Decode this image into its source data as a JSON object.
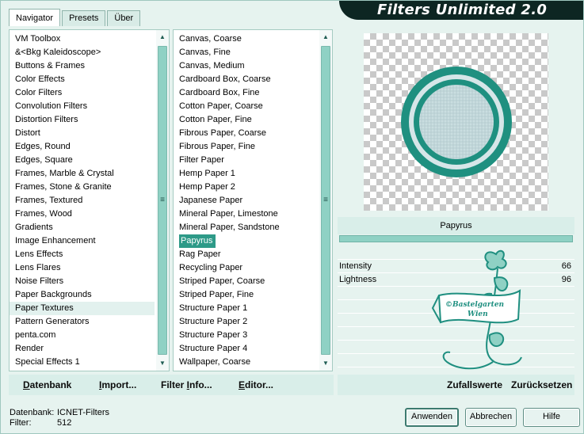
{
  "tabs": [
    {
      "label": "Navigator",
      "active": true
    },
    {
      "label": "Presets",
      "active": false
    },
    {
      "label": "Über",
      "active": false
    }
  ],
  "brand_title": "Filters Unlimited 2.0",
  "categories": {
    "items": [
      "VM Toolbox",
      "&<Bkg Kaleidoscope>",
      "Buttons & Frames",
      "Color Effects",
      "Color Filters",
      "Convolution Filters",
      "Distortion Filters",
      "Distort",
      "Edges, Round",
      "Edges, Square",
      "Frames, Marble & Crystal",
      "Frames, Stone & Granite",
      "Frames, Textured",
      "Frames, Wood",
      "Gradients",
      "Image Enhancement",
      "Lens Effects",
      "Lens Flares",
      "Noise Filters",
      "Paper Backgrounds",
      "Paper Textures",
      "Pattern Generators",
      "penta.com",
      "Render",
      "Special Effects 1"
    ],
    "selected": "Paper Textures"
  },
  "filters": {
    "items": [
      "Canvas, Coarse",
      "Canvas, Fine",
      "Canvas, Medium",
      "Cardboard Box, Coarse",
      "Cardboard Box, Fine",
      "Cotton Paper, Coarse",
      "Cotton Paper, Fine",
      "Fibrous Paper, Coarse",
      "Fibrous Paper, Fine",
      "Filter Paper",
      "Hemp Paper 1",
      "Hemp Paper 2",
      "Japanese Paper",
      "Mineral Paper, Limestone",
      "Mineral Paper, Sandstone",
      "Papyrus",
      "Rag Paper",
      "Recycling Paper",
      "Striped Paper, Coarse",
      "Striped Paper, Fine",
      "Structure Paper 1",
      "Structure Paper 2",
      "Structure Paper 3",
      "Structure Paper 4",
      "Wallpaper, Coarse"
    ],
    "selected": "Papyrus"
  },
  "preview": {
    "filter_name": "Papyrus"
  },
  "params": [
    {
      "label": "Intensity",
      "value": "66"
    },
    {
      "label": "Lightness",
      "value": "96"
    }
  ],
  "watermark_text": [
    "©Bastelgarten",
    "Wien"
  ],
  "bottom_left_buttons": [
    {
      "label": "Datenbank",
      "underline": "D",
      "rest": "atenbank"
    },
    {
      "label": "Import...",
      "underline": "I",
      "rest": "mport..."
    },
    {
      "label": "Filter Info...",
      "prefix": "Filter ",
      "underline": "I",
      "rest": "nfo..."
    },
    {
      "label": "Editor...",
      "underline": "E",
      "rest": "ditor..."
    }
  ],
  "bottom_right_buttons": [
    {
      "label": "Zufallswerte"
    },
    {
      "label": "Zurücksetzen"
    }
  ],
  "status": {
    "db_label": "Datenbank:",
    "db_value": "ICNET-Filters",
    "filter_label": "Filter:",
    "filter_value": "512"
  },
  "dialog_buttons": {
    "apply": "Anwenden",
    "cancel": "Abbrechen",
    "help": "Hilfe"
  },
  "colors": {
    "accent": "#2e9a88",
    "brand_bar": "#0d2622",
    "scroll_thumb": "#8fd1c4",
    "panel_bg": "#e6f3ef"
  }
}
